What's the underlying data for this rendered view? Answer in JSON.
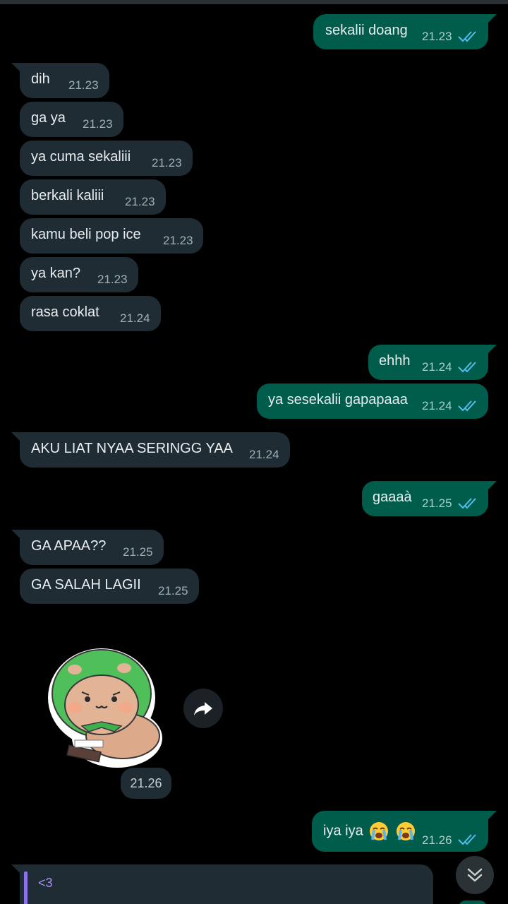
{
  "messages": [
    {
      "dir": "out",
      "text": "sekalii doang",
      "time": "21.23",
      "read": true
    },
    {
      "dir": "in",
      "text": "dih",
      "time": "21.23"
    },
    {
      "dir": "in",
      "text": "ga ya",
      "time": "21.23"
    },
    {
      "dir": "in",
      "text": "ya cuma sekaliii",
      "time": "21.23"
    },
    {
      "dir": "in",
      "text": "berkali kaliii",
      "time": "21.23"
    },
    {
      "dir": "in",
      "text": "kamu beli pop ice",
      "time": "21.23"
    },
    {
      "dir": "in",
      "text": "ya kan?",
      "time": "21.23"
    },
    {
      "dir": "in",
      "text": "rasa coklat",
      "time": "21.24"
    },
    {
      "dir": "out",
      "text": "ehhh",
      "time": "21.24",
      "read": true
    },
    {
      "dir": "out",
      "text": "ya sesekalii gapapaaa",
      "time": "21.24",
      "read": true
    },
    {
      "dir": "in",
      "text": "AKU LIAT NYAA SERINGG YAA",
      "time": "21.24"
    },
    {
      "dir": "out",
      "text": "gaaaà",
      "time": "21.25",
      "read": true
    },
    {
      "dir": "in",
      "text": "GA APAA??",
      "time": "21.25"
    },
    {
      "dir": "in",
      "text": "GA SALAH LAGII",
      "time": "21.25"
    }
  ],
  "sticker": {
    "time": "21.26",
    "icon": "bear-in-green-hood-sticker"
  },
  "last_out": {
    "text": "iya iya",
    "emoji": "loudly-crying-face",
    "time": "21.26",
    "read": true
  },
  "reply_preview": {
    "text": "<3"
  },
  "colors": {
    "incoming": "#1f2c34",
    "outgoing": "#005c4b",
    "read_ticks": "#53bdeb",
    "reply_accent": "#8b72e8"
  }
}
